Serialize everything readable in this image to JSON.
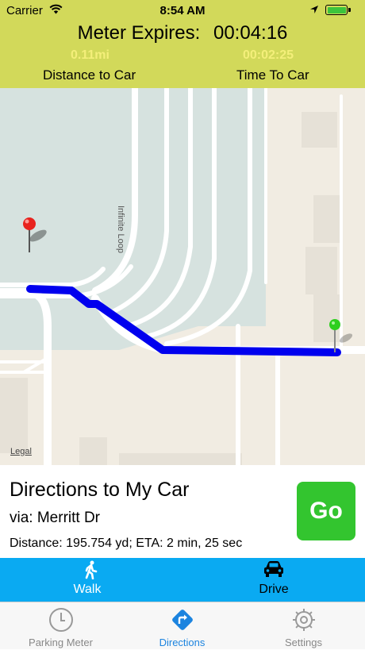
{
  "status_bar": {
    "carrier": "Carrier",
    "time": "8:54 AM"
  },
  "meter": {
    "expires_label": "Meter Expires:",
    "expires_value": "00:04:16",
    "distance_value": "0.11mi",
    "distance_label": "Distance to Car",
    "time_value": "00:02:25",
    "time_label": "Time To Car"
  },
  "map": {
    "street_label": "Infinite Loop",
    "legal_label": "Legal",
    "route_color": "#0000ee",
    "car_pin_color": "#e8231e",
    "user_pin_color": "#2ecf1e"
  },
  "directions": {
    "title": "Directions to My Car",
    "via": "via: Merritt Dr",
    "distance_eta": "Distance: 195.754 yd; ETA: 2 min, 25 sec",
    "go_label": "Go"
  },
  "modes": [
    {
      "label": "Walk",
      "icon": "walk-icon",
      "selected": true
    },
    {
      "label": "Drive",
      "icon": "car-icon",
      "selected": false
    }
  ],
  "tabs": [
    {
      "label": "Parking Meter",
      "icon": "clock-icon"
    },
    {
      "label": "Directions",
      "icon": "directions-icon",
      "active": true
    },
    {
      "label": "Settings",
      "icon": "gear-icon"
    }
  ]
}
